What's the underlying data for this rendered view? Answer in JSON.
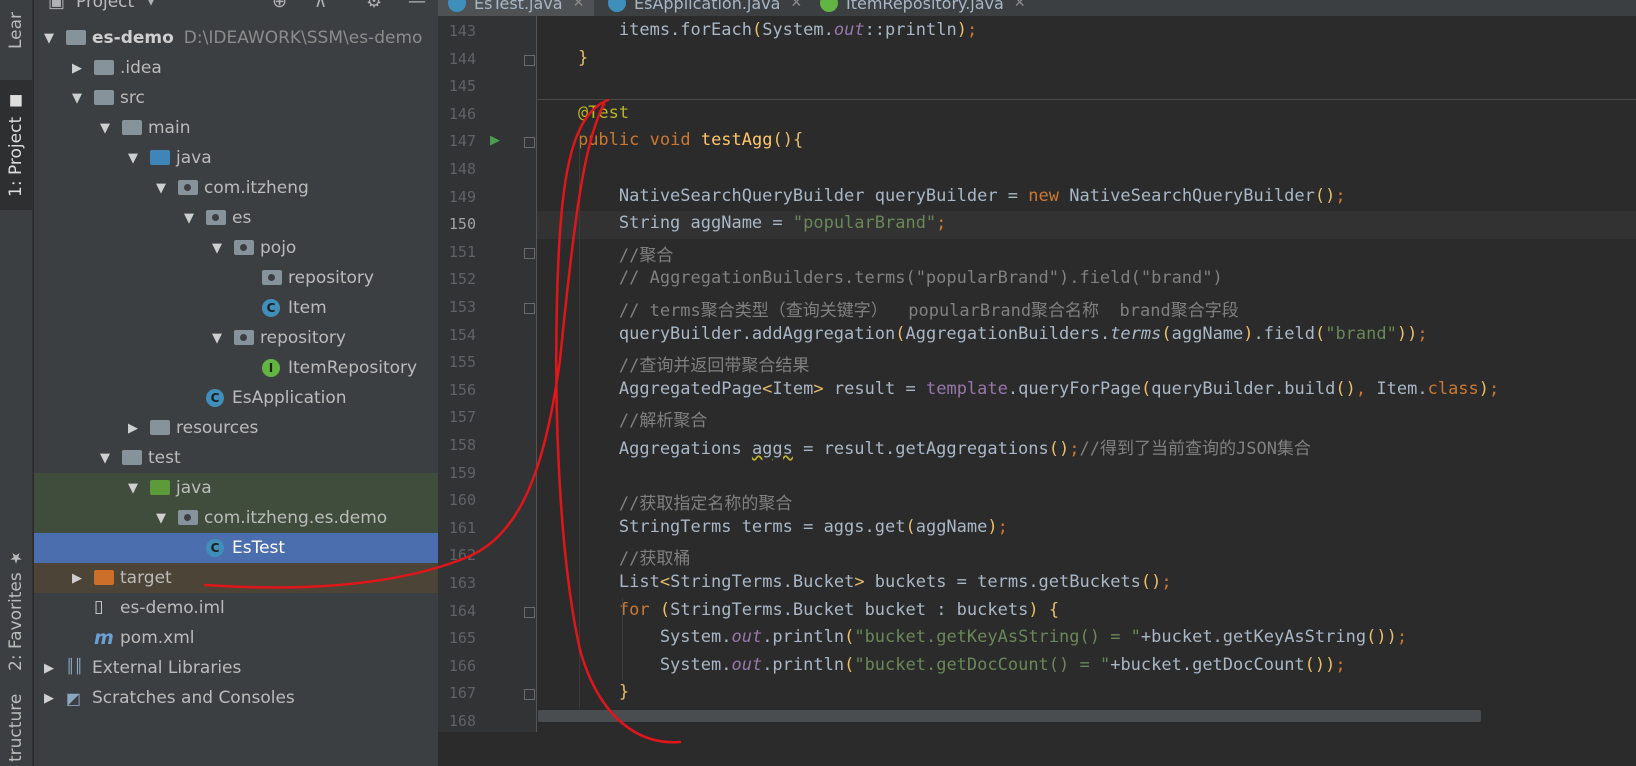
{
  "left_strip": {
    "learn_label": "Lear",
    "project_label": "1: Project",
    "favorites_label": "2: Favorites",
    "structure_label": "tructure"
  },
  "project_panel": {
    "title": "Project",
    "tree": [
      {
        "label": "es-demo",
        "path": "D:\\IDEAWORK\\SSM\\es-demo",
        "icon": "module-folder-icon",
        "arrow": "▼",
        "bold": true
      },
      {
        "label": ".idea",
        "icon": "folder-icon",
        "arrow": "▶"
      },
      {
        "label": "src",
        "icon": "folder-icon",
        "arrow": "▼"
      },
      {
        "label": "main",
        "icon": "folder-icon",
        "arrow": "▼"
      },
      {
        "label": "java",
        "icon": "source-folder-icon",
        "arrow": "▼"
      },
      {
        "label": "com.itzheng",
        "icon": "package-icon",
        "arrow": "▼"
      },
      {
        "label": "es",
        "icon": "package-icon",
        "arrow": "▼"
      },
      {
        "label": "pojo",
        "icon": "package-icon",
        "arrow": "▼"
      },
      {
        "label": "repository",
        "icon": "package-icon",
        "arrow": ""
      },
      {
        "label": "Item",
        "icon": "class-icon",
        "arrow": ""
      },
      {
        "label": "repository",
        "icon": "package-icon",
        "arrow": "▼"
      },
      {
        "label": "ItemRepository",
        "icon": "interface-icon",
        "arrow": ""
      },
      {
        "label": "EsApplication",
        "icon": "spring-boot-class-icon",
        "arrow": ""
      },
      {
        "label": "resources",
        "icon": "resources-folder-icon",
        "arrow": "▶"
      },
      {
        "label": "test",
        "icon": "folder-icon",
        "arrow": "▼"
      },
      {
        "label": "java",
        "icon": "test-source-folder-icon",
        "arrow": "▼"
      },
      {
        "label": "com.itzheng.es.demo",
        "icon": "package-icon",
        "arrow": "▼"
      },
      {
        "label": "EsTest",
        "icon": "test-class-icon",
        "arrow": "",
        "selected": true
      },
      {
        "label": "target",
        "icon": "excluded-folder-icon",
        "arrow": "▶"
      },
      {
        "label": "es-demo.iml",
        "icon": "iml-file-icon",
        "arrow": ""
      },
      {
        "label": "pom.xml",
        "icon": "maven-icon",
        "arrow": ""
      },
      {
        "label": "External Libraries",
        "icon": "libraries-icon",
        "arrow": "▶"
      },
      {
        "label": "Scratches and Consoles",
        "icon": "scratches-icon",
        "arrow": "▶"
      }
    ]
  },
  "tabs": [
    {
      "label": "EsTest.java",
      "icon": "class-icon",
      "active": true
    },
    {
      "label": "EsApplication.java",
      "icon": "spring-boot-class-icon",
      "active": false
    },
    {
      "label": "ItemRepository.java",
      "icon": "interface-icon",
      "active": false
    }
  ],
  "editor": {
    "current_line": "150",
    "lines": [
      {
        "num": "143",
        "code": "        items.forEach(System.out::println);"
      },
      {
        "num": "144",
        "code": "    }"
      },
      {
        "num": "145",
        "code": ""
      },
      {
        "num": "146",
        "code": "    @Test"
      },
      {
        "num": "147",
        "code": "    public void testAgg(){"
      },
      {
        "num": "148",
        "code": ""
      },
      {
        "num": "149",
        "code": "        NativeSearchQueryBuilder queryBuilder = new NativeSearchQueryBuilder();"
      },
      {
        "num": "150",
        "code": "        String aggName = \"popularBrand\";"
      },
      {
        "num": "151",
        "code": "        //聚合"
      },
      {
        "num": "152",
        "code": "        // AggregationBuilders.terms(\"popularBrand\").field(\"brand\")"
      },
      {
        "num": "153",
        "code": "        // terms聚合类型（查询关键字）  popularBrand聚合名称  brand聚合字段"
      },
      {
        "num": "154",
        "code": "        queryBuilder.addAggregation(AggregationBuilders.terms(aggName).field(\"brand\"));"
      },
      {
        "num": "155",
        "code": "        //查询并返回带聚合结果"
      },
      {
        "num": "156",
        "code": "        AggregatedPage<Item> result = template.queryForPage(queryBuilder.build(), Item.class);"
      },
      {
        "num": "157",
        "code": "        //解析聚合"
      },
      {
        "num": "158",
        "code": "        Aggregations aggs = result.getAggregations();//得到了当前查询的JSON集合"
      },
      {
        "num": "159",
        "code": ""
      },
      {
        "num": "160",
        "code": "        //获取指定名称的聚合"
      },
      {
        "num": "161",
        "code": "        StringTerms terms = aggs.get(aggName);"
      },
      {
        "num": "162",
        "code": "        //获取桶"
      },
      {
        "num": "163",
        "code": "        List<StringTerms.Bucket> buckets = terms.getBuckets();"
      },
      {
        "num": "164",
        "code": "        for (StringTerms.Bucket bucket : buckets) {"
      },
      {
        "num": "165",
        "code": "            System.out.println(\"bucket.getKeyAsString() = \"+bucket.getKeyAsString());"
      },
      {
        "num": "166",
        "code": "            System.out.println(\"bucket.getDocCount() = \"+bucket.getDocCount());"
      },
      {
        "num": "167",
        "code": "        }"
      },
      {
        "num": "168",
        "code": ""
      }
    ]
  },
  "colors": {
    "keyword": "#cc7832",
    "string": "#6a8759",
    "comment": "#808080",
    "annotation": "#bbb529",
    "method": "#ffc66d",
    "selection": "#4b6eaf",
    "annotation_ink": "#e0161b"
  }
}
